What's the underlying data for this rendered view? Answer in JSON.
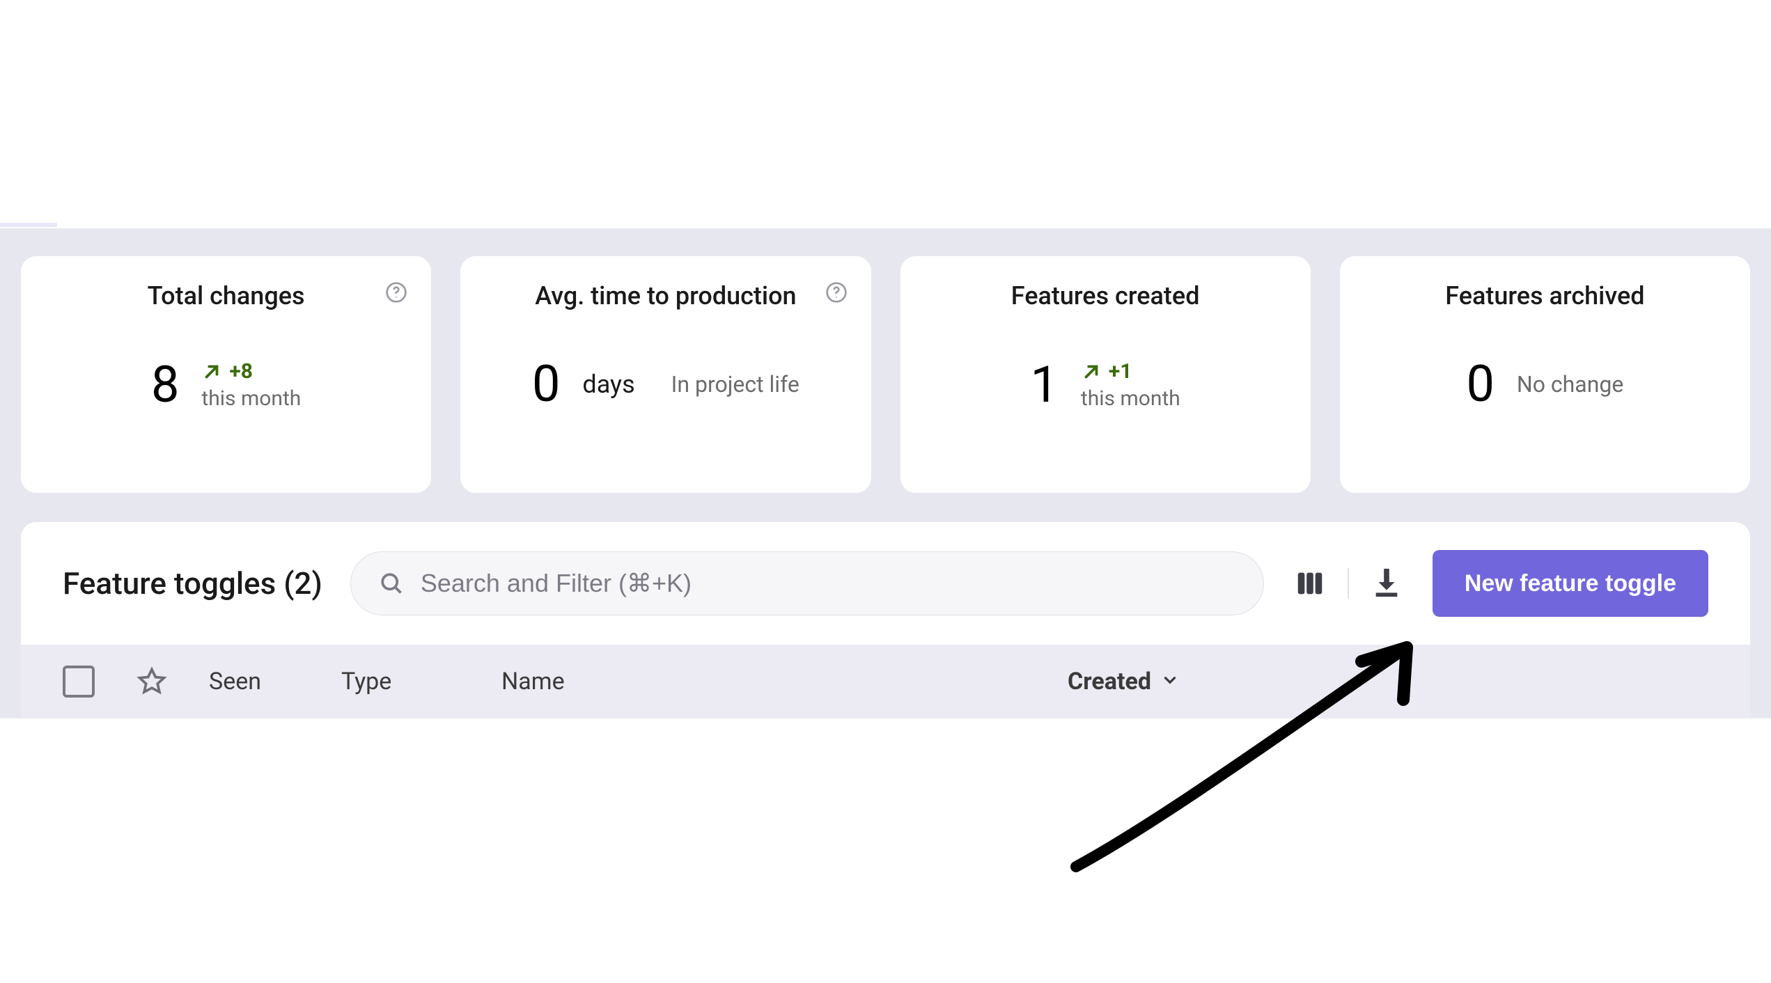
{
  "stats": [
    {
      "title": "Total changes",
      "value": "8",
      "delta": "+8",
      "period": "this month",
      "has_help": true,
      "trend": "up"
    },
    {
      "title": "Avg. time to production",
      "value": "0",
      "unit": "days",
      "subtext": "In project life",
      "has_help": true
    },
    {
      "title": "Features created",
      "value": "1",
      "delta": "+1",
      "period": "this month",
      "has_help": false,
      "trend": "up"
    },
    {
      "title": "Features archived",
      "value": "0",
      "nochange": "No change",
      "has_help": false
    }
  ],
  "toggles": {
    "title": "Feature toggles (2)",
    "search_placeholder": "Search and Filter (⌘+K)",
    "new_button": "New feature toggle"
  },
  "table": {
    "columns": {
      "seen": "Seen",
      "type": "Type",
      "name": "Name",
      "created": "Created"
    }
  }
}
